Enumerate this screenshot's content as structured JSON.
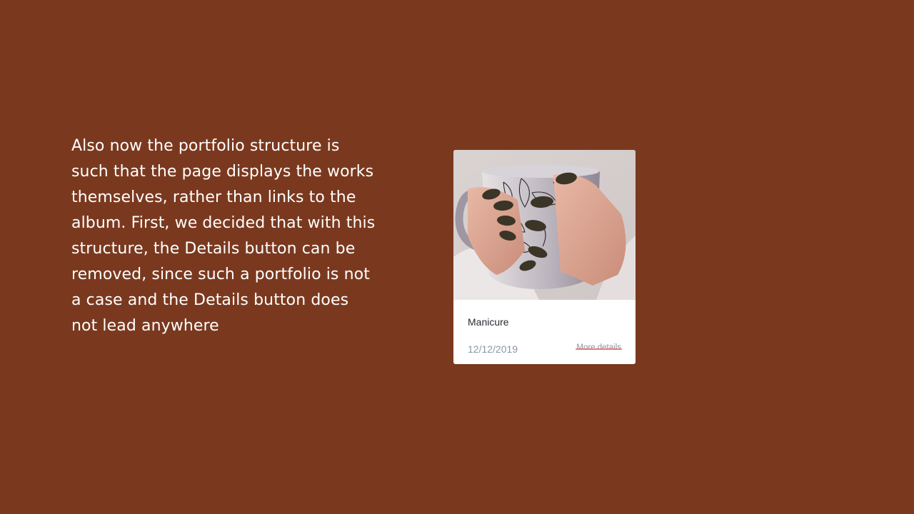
{
  "description": {
    "text": "Also now the portfolio structure is such that the page displays the works themselves, rather than links to the album. First, we decided that with this structure, the Details button can be removed, since such a portfolio is not a case and the Details button does not lead anywhere"
  },
  "card": {
    "title": "Manicure",
    "date": "12/12/2019",
    "link_label": "More details",
    "photo_icon": "photo-hands-holding-mug"
  },
  "colors": {
    "background": "#7a391f",
    "card": "#ffffff",
    "strike": "#e07a7a",
    "muted_text": "#8a95a5"
  }
}
